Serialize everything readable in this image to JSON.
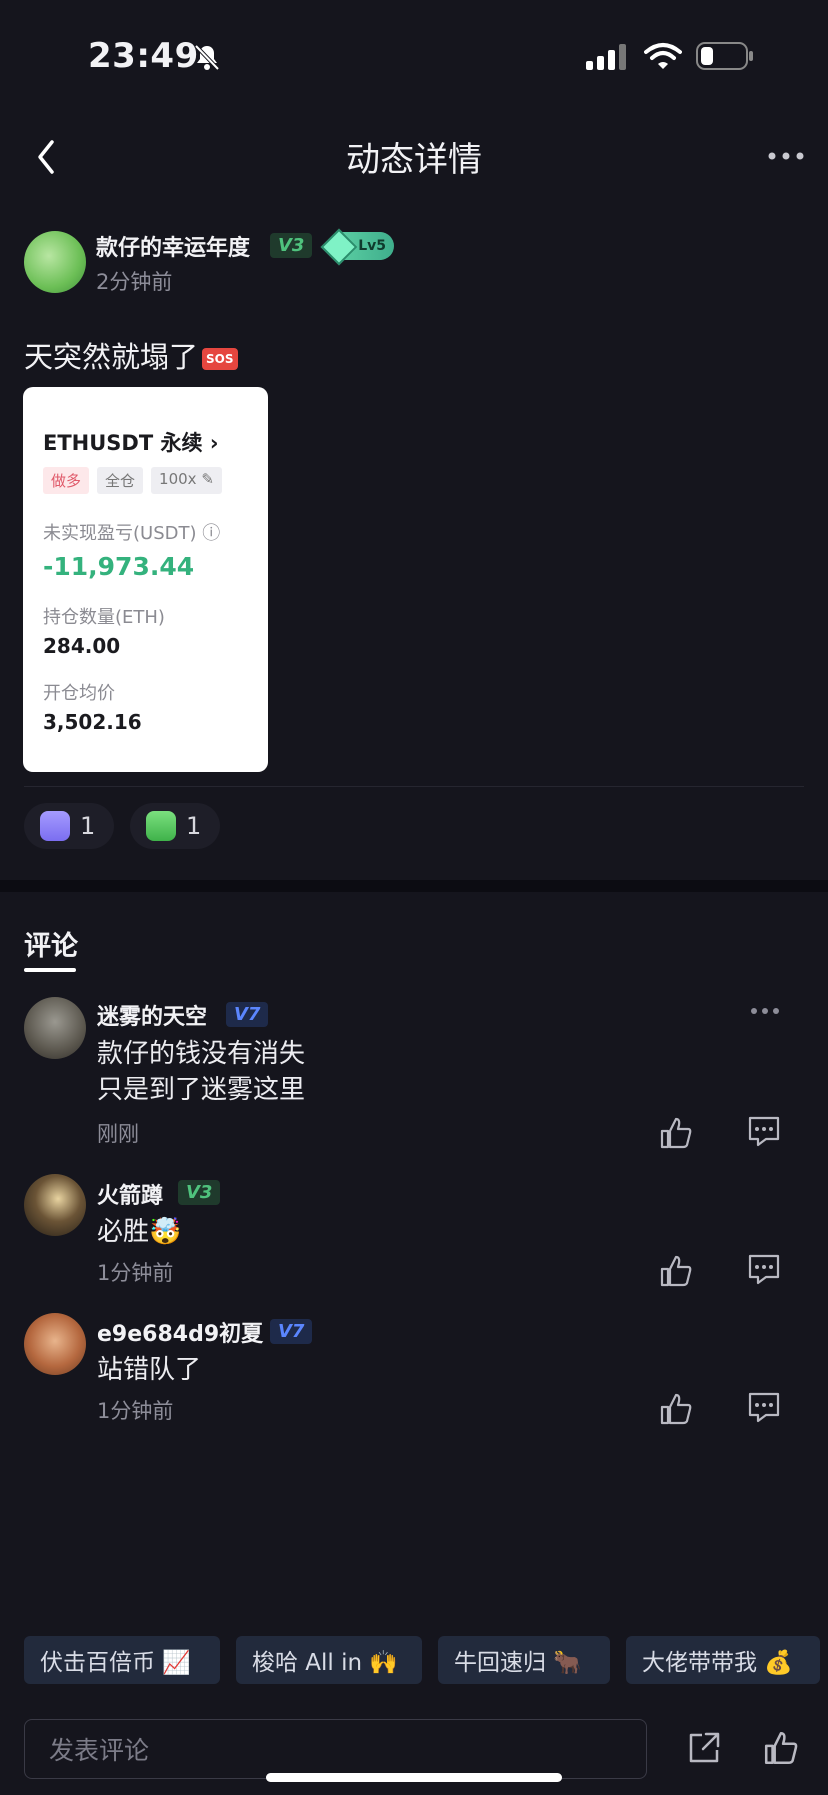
{
  "status_bar": {
    "time": "23:49"
  },
  "nav": {
    "title": "动态详情"
  },
  "post": {
    "author_name": "款仔的幸运年度",
    "author_vip": "V3",
    "author_level": "Lv5",
    "time": "2分钟前",
    "text": "天突然就塌了",
    "emoji": "SOS",
    "card": {
      "title": "ETHUSDT 永续",
      "tags": [
        "做多",
        "全仓",
        "100x"
      ],
      "pnl_label": "未实现盈亏(USDT)",
      "pnl_value": "-11,973.44",
      "position_label": "持仓数量(ETH)",
      "position_value": "284.00",
      "entry_label": "开仓均价",
      "entry_value": "3,502.16"
    },
    "reactions": [
      {
        "icon": "robot-emoji-icon",
        "count": "1"
      },
      {
        "icon": "frog-emoji-icon",
        "count": "1"
      }
    ]
  },
  "comments_tab": "评论",
  "comments": [
    {
      "name": "迷雾的天空",
      "vip": "V7",
      "text_line1": "款仔的钱没有消失",
      "text_line2": "只是到了迷雾这里",
      "time": "刚刚"
    },
    {
      "name": "火箭蹲",
      "vip": "V3",
      "text_line1": "必胜🤯",
      "time": "1分钟前"
    },
    {
      "name": "e9e684d9初夏",
      "vip": "V7",
      "text_line1": "站错队了",
      "time": "1分钟前"
    }
  ],
  "quick_tags": [
    "伏击百倍币 📈",
    "梭哈 All in 🙌",
    "牛回速归 🐂",
    "大佬带带我 💰"
  ],
  "comment_input": {
    "placeholder": "发表评论"
  },
  "colors": {
    "background": "#15151d",
    "pnl_green": "#34b27d",
    "v3": "#4fc27d",
    "v7": "#5b86ff"
  }
}
